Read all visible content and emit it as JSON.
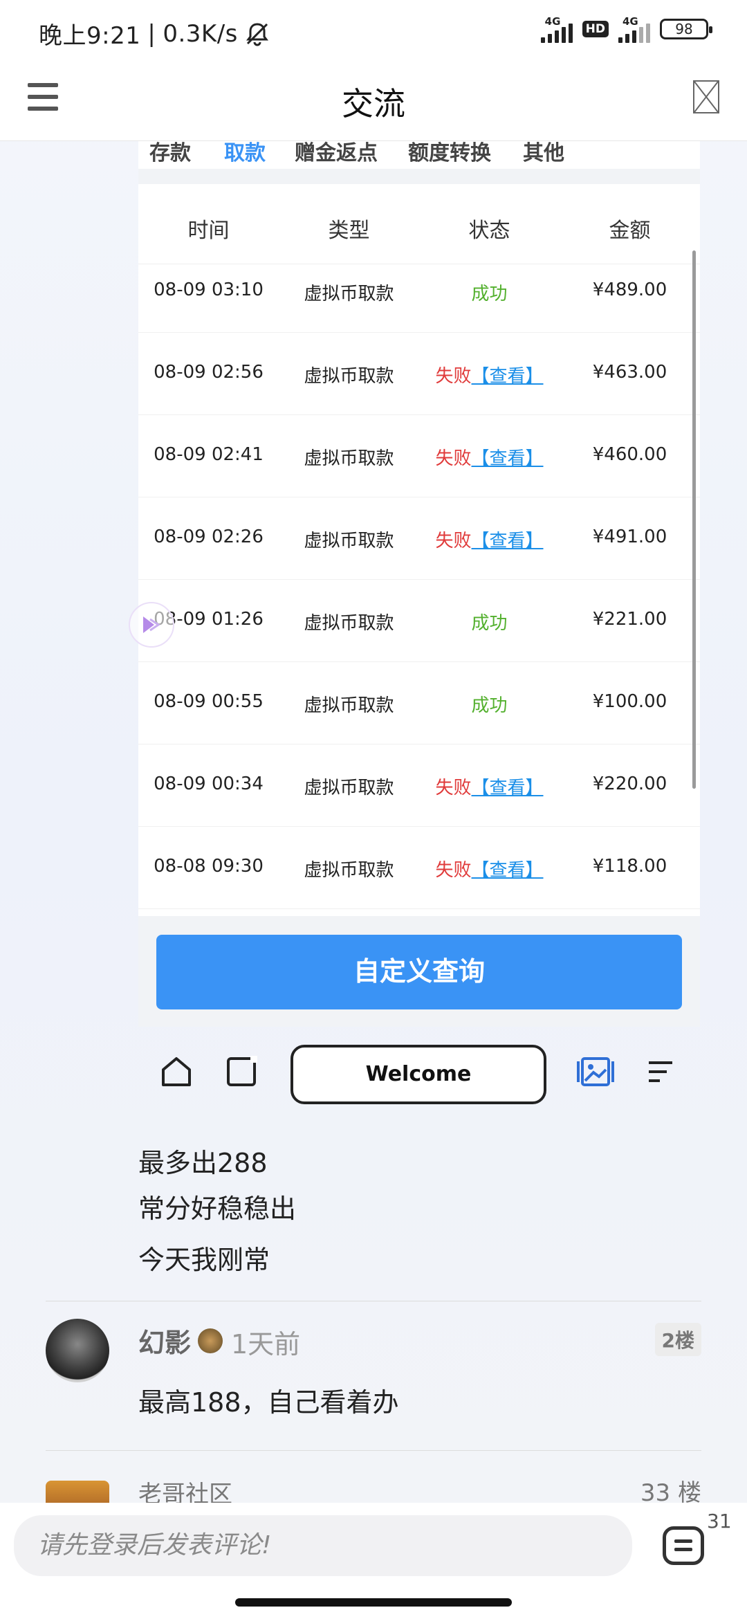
{
  "status_bar": {
    "time": "晚上9:21",
    "speed": "0.3K/s",
    "network1": "4G",
    "hd": "HD",
    "network2": "4G",
    "battery": "98"
  },
  "header": {
    "title": "交流"
  },
  "tabs": [
    "存款",
    "取款",
    "赠金返点",
    "额度转换",
    "其他"
  ],
  "table": {
    "headers": [
      "时间",
      "类型",
      "状态",
      "金额"
    ],
    "rows": [
      {
        "time": "08-09 03:10",
        "type": "虚拟币取款",
        "status": "成功",
        "view": "",
        "amount": "¥489.00"
      },
      {
        "time": "08-09 02:56",
        "type": "虚拟币取款",
        "status": "失败",
        "view": "【查看】",
        "amount": "¥463.00"
      },
      {
        "time": "08-09 02:41",
        "type": "虚拟币取款",
        "status": "失败",
        "view": "【查看】",
        "amount": "¥460.00"
      },
      {
        "time": "08-09 02:26",
        "type": "虚拟币取款",
        "status": "失败",
        "view": "【查看】",
        "amount": "¥491.00"
      },
      {
        "time": "08-09 01:26",
        "type": "虚拟币取款",
        "status": "成功",
        "view": "",
        "amount": "¥221.00"
      },
      {
        "time": "08-09 00:55",
        "type": "虚拟币取款",
        "status": "成功",
        "view": "",
        "amount": "¥100.00"
      },
      {
        "time": "08-09 00:34",
        "type": "虚拟币取款",
        "status": "失败",
        "view": "【查看】",
        "amount": "¥220.00"
      },
      {
        "time": "08-08 09:30",
        "type": "虚拟币取款",
        "status": "失败",
        "view": "【查看】",
        "amount": "¥118.00"
      }
    ]
  },
  "query_button": "自定义查询",
  "browser": {
    "welcome": "Welcome"
  },
  "post": {
    "lines": [
      "最多出288",
      "常分好稳稳出",
      "今天我刚常"
    ]
  },
  "comment": {
    "name": "幻影",
    "time": "1天前",
    "floor": "2楼",
    "text": "最高188，自己看着办"
  },
  "next_item": {
    "site": "老哥社区",
    "floor": "33 楼"
  },
  "bottom": {
    "placeholder": "请先登录后发表评论!",
    "comment_count": "31"
  },
  "colors": {
    "accent": "#3a93f5",
    "success": "#53b02e",
    "fail": "#e03a3a",
    "link": "#1b8fe8"
  }
}
